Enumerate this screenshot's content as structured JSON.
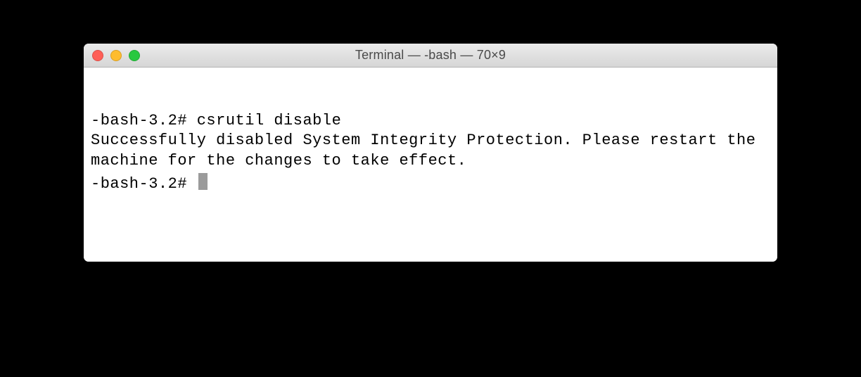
{
  "window": {
    "title": "Terminal — -bash — 70×9"
  },
  "terminal": {
    "line1_prompt": "-bash-3.2# ",
    "line1_command": "csrutil disable",
    "output": "Successfully disabled System Integrity Protection. Please restart the machine for the changes to take effect.",
    "line2_prompt": "-bash-3.2# "
  }
}
